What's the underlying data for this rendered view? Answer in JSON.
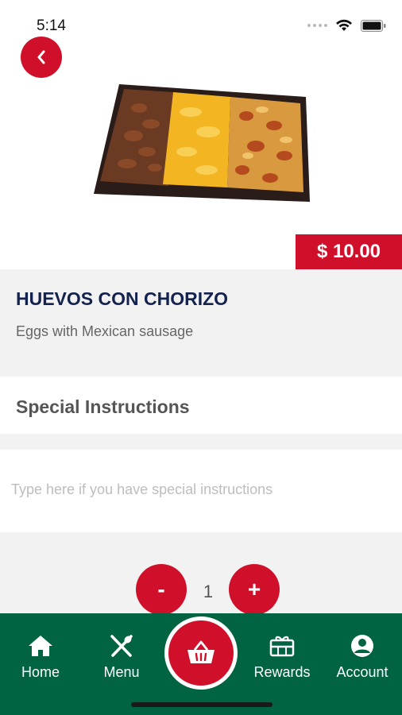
{
  "status_bar": {
    "time": "5:14"
  },
  "item": {
    "price": "$ 10.00",
    "title": "HUEVOS CON CHORIZO",
    "description": "Eggs with Mexican sausage"
  },
  "special_instructions": {
    "title": "Special Instructions",
    "placeholder": "Type here if you have special instructions",
    "value": ""
  },
  "quantity": {
    "minus_label": "-",
    "value": "1",
    "plus_label": "+"
  },
  "nav": {
    "home": "Home",
    "menu": "Menu",
    "rewards": "Rewards",
    "account": "Account"
  },
  "colors": {
    "accent_red": "#d0102a",
    "nav_green": "#006341",
    "title_navy": "#14224e"
  }
}
